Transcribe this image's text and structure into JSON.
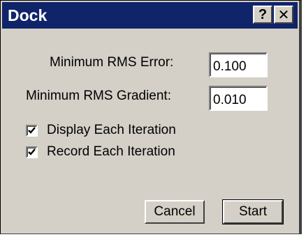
{
  "window": {
    "title": "Dock",
    "help_label": "?",
    "close_label": "✕"
  },
  "form": {
    "rms_error_label": "Minimum RMS Error:",
    "rms_error_value": "0.100",
    "rms_gradient_label": "Minimum RMS Gradient:",
    "rms_gradient_value": "0.010",
    "display_each_label": "Display Each Iteration",
    "display_each_checked": true,
    "record_each_label": "Record Each Iteration",
    "record_each_checked": true
  },
  "buttons": {
    "cancel_label": "Cancel",
    "start_label": "Start"
  }
}
